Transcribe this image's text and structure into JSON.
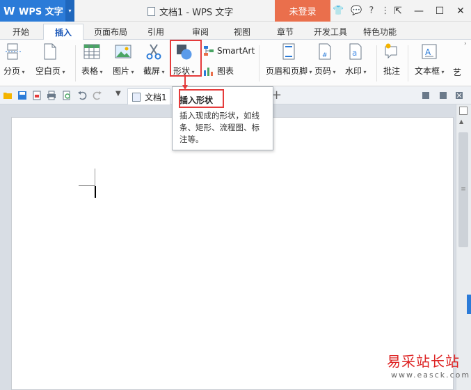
{
  "app": {
    "name": "WPS 文字",
    "logo": "W",
    "dropdown_icon": "▾"
  },
  "window": {
    "title": "文档1 - WPS 文字",
    "login_label": "未登录"
  },
  "title_icons": [
    "shirt-icon",
    "chat-icon",
    "help-icon",
    "menu-icon"
  ],
  "title_icon_glyphs": [
    "👕",
    "💬",
    "?",
    "⋮"
  ],
  "win_controls": {
    "restore": "⇱",
    "minimize": "—",
    "maximize": "☐",
    "close": "✕"
  },
  "tabs": [
    {
      "label": "开始",
      "active": false
    },
    {
      "label": "插入",
      "active": true
    },
    {
      "label": "页面布局",
      "active": false
    },
    {
      "label": "引用",
      "active": false
    },
    {
      "label": "审阅",
      "active": false
    },
    {
      "label": "视图",
      "active": false
    },
    {
      "label": "章节",
      "active": false
    },
    {
      "label": "开发工具",
      "active": false
    },
    {
      "label": "特色功能",
      "active": false
    }
  ],
  "ribbon": {
    "page_break": "分页",
    "blank_page": "空白页",
    "table": "表格",
    "picture": "图片",
    "screenshot": "截屏",
    "shape": "形状",
    "smartart": "SmartArt",
    "chart": "图表",
    "header_footer": "页眉和页脚",
    "page_number": "页码",
    "watermark": "水印",
    "comment": "批注",
    "textbox": "文本框",
    "art": "艺"
  },
  "doc_tab": {
    "label": "文档1"
  },
  "tooltip": {
    "title": "插入形状",
    "body": "插入现成的形状，如线条、矩形、流程图、标注等。"
  },
  "watermark_site": {
    "line1": "易采站长站",
    "line2": "www.easck.com"
  },
  "colors": {
    "accent_blue": "#2b7bd8",
    "login_orange": "#ea6f4c",
    "highlight_red": "#e53b3b"
  }
}
